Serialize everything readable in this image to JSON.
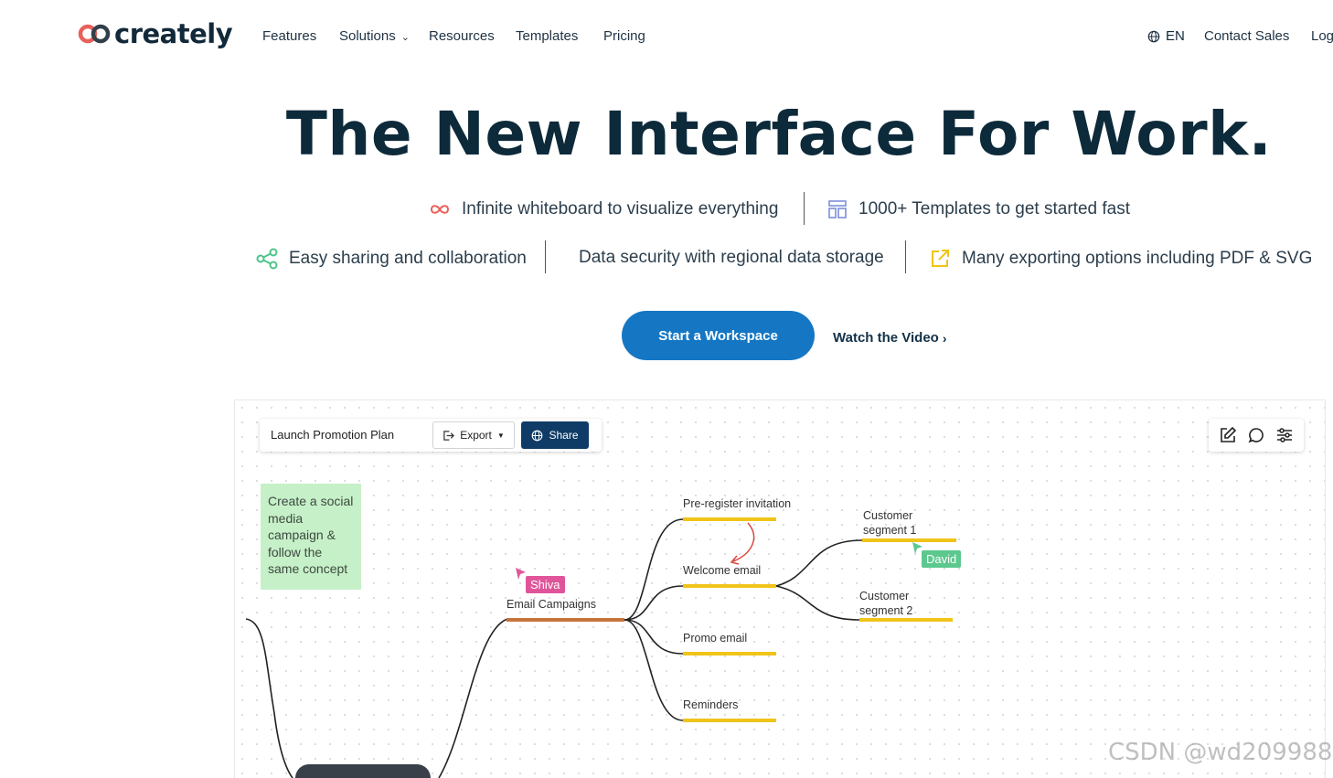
{
  "nav": {
    "logo": "creately",
    "items": [
      "Features",
      "Solutions",
      "Resources",
      "Templates",
      "Pricing"
    ],
    "language": "EN",
    "contact": "Contact Sales",
    "login": "Log"
  },
  "hero": {
    "title": "The New Interface For Work.",
    "features": [
      "Infinite whiteboard to visualize everything",
      "1000+ Templates to get started fast",
      "Easy sharing and collaboration",
      "Data security with regional data storage",
      "Many exporting options including PDF & SVG"
    ],
    "cta_primary": "Start a Workspace",
    "cta_secondary": "Watch the Video"
  },
  "board": {
    "doc_title": "Launch Promotion Plan",
    "export_label": "Export",
    "share_label": "Share",
    "sticky_note": "Create a social media campaign & follow the same concept",
    "nodes": {
      "email_campaigns": "Email Campaigns",
      "pre_register": "Pre-register invitation",
      "welcome": "Welcome email",
      "promo": "Promo email",
      "reminders": "Reminders",
      "segment1_line1": "Customer",
      "segment1_line2": "segment 1",
      "segment2_line1": "Customer",
      "segment2_line2": "segment 2"
    },
    "cursors": {
      "shiva": "Shiva",
      "david": "David"
    }
  },
  "watermark": "CSDN @wd209988",
  "colors": {
    "primary": "#1577c4",
    "title": "#0d2a3a",
    "branch_orange": "#c8733a",
    "branch_yellow": "#f0c419",
    "sticky": "#c6f0c8",
    "shiva": "#e0559a",
    "david": "#5cc88e"
  }
}
